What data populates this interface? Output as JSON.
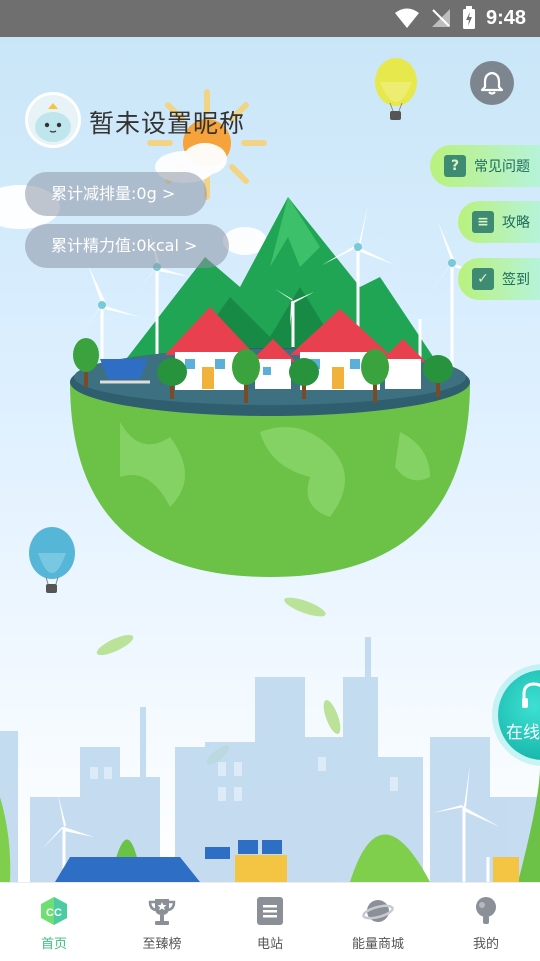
{
  "status_bar": {
    "time": "9:48"
  },
  "user": {
    "nickname": "暂未设置昵称"
  },
  "stats": {
    "emission_reduction": "累计减排量:0g >",
    "energy_value": "累计精力值:0kcal >"
  },
  "side_menu": {
    "faq": "常见问题",
    "guide": "攻略",
    "checkin": "签到"
  },
  "online_service": "在线",
  "tabs": [
    {
      "label": "首页",
      "active": true
    },
    {
      "label": "至臻榜"
    },
    {
      "label": "电站"
    },
    {
      "label": "能量商城"
    },
    {
      "label": "我的"
    }
  ],
  "colors": {
    "accent": "#3cc07a",
    "side_button": "#b9f27c",
    "online": "#19b9ad"
  }
}
